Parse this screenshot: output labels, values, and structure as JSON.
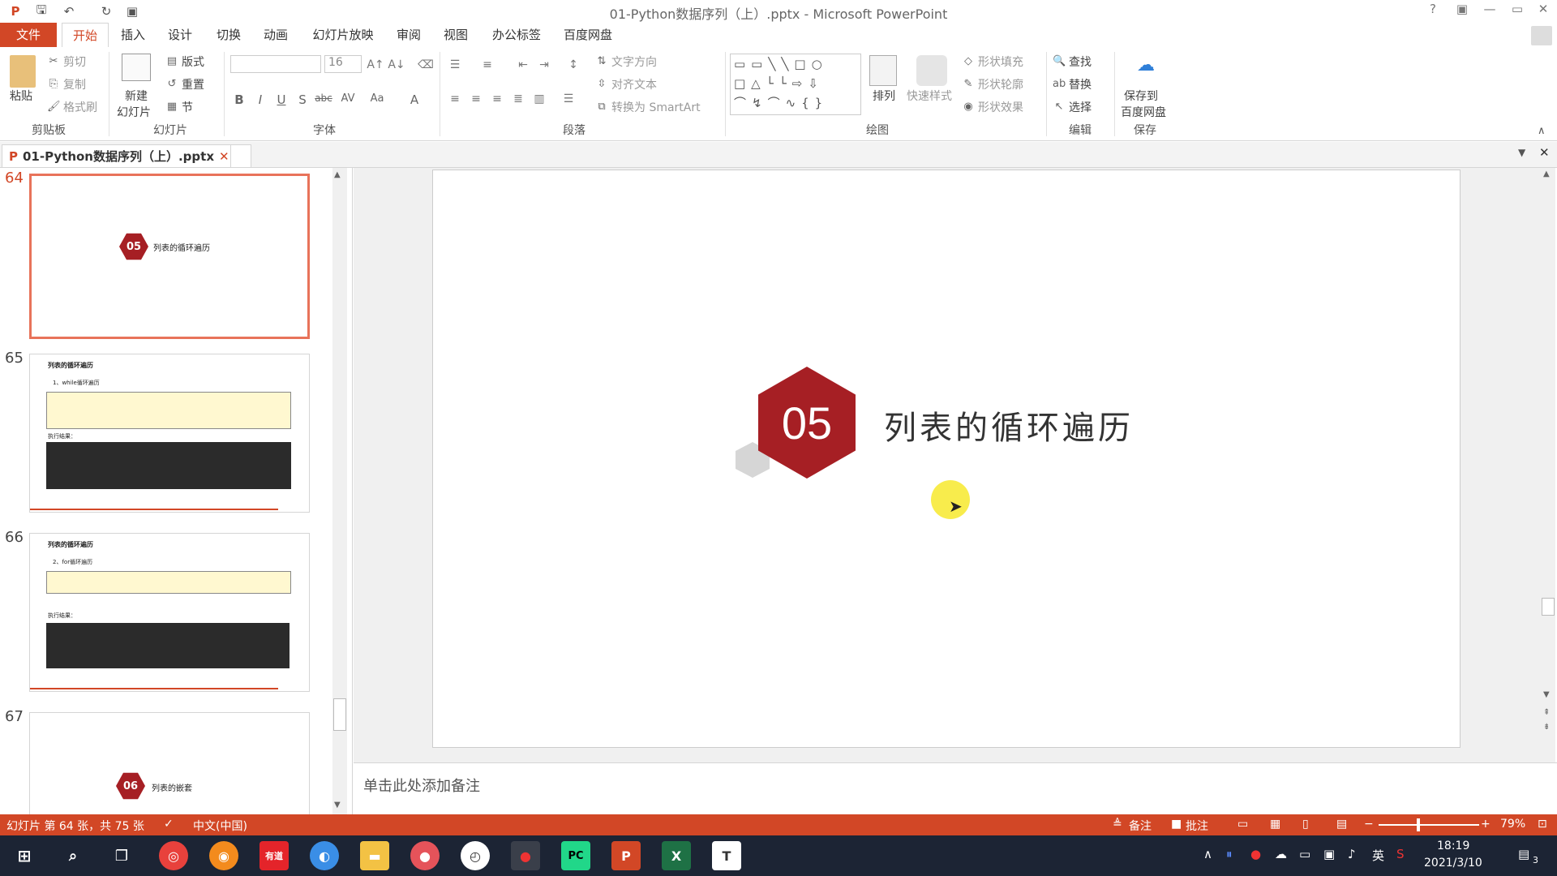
{
  "window": {
    "title": "01-Python数据序列（上）.pptx - Microsoft PowerPoint",
    "help": "?",
    "min": "—",
    "max": "▭",
    "close": "✕"
  },
  "tabs": [
    "文件",
    "开始",
    "插入",
    "设计",
    "切换",
    "动画",
    "幻灯片放映",
    "审阅",
    "视图",
    "办公标签",
    "百度网盘"
  ],
  "ribbon": {
    "clipboard": {
      "paste": "粘贴",
      "cut": "剪切",
      "copy": "复制",
      "format_painter": "格式刷",
      "label": "剪贴板"
    },
    "slides": {
      "new": "新建",
      "new2": "幻灯片",
      "layout": "版式",
      "reset": "重置",
      "section": "节",
      "label": "幻灯片"
    },
    "font": {
      "name": "",
      "size": "16",
      "label": "字体"
    },
    "paragraph": {
      "text_direction": "文字方向",
      "align_text": "对齐文本",
      "smartart": "转换为 SmartArt",
      "label": "段落"
    },
    "drawing": {
      "arrange": "排列",
      "quick_styles": "快速样式",
      "fill": "形状填充",
      "outline": "形状轮廓",
      "effects": "形状效果",
      "label": "绘图"
    },
    "editing": {
      "find": "查找",
      "replace": "替换",
      "select": "选择",
      "label": "编辑"
    },
    "save": {
      "save_to": "保存到",
      "baidu": "百度网盘",
      "label": "保存"
    }
  },
  "doc_tab": {
    "name": "01-Python数据序列（上）.pptx"
  },
  "thumbnails": [
    {
      "num": "64",
      "badge": "05",
      "title": "列表的循环遍历",
      "selected": true
    },
    {
      "num": "65",
      "title": "列表的循环遍历",
      "subtitle": "1、while循环遍历",
      "result": "执行结果："
    },
    {
      "num": "66",
      "title": "列表的循环遍历",
      "subtitle": "2、for循环遍历",
      "result": "执行结果："
    },
    {
      "num": "67",
      "badge": "06",
      "title": "列表的嵌套"
    }
  ],
  "slide": {
    "badge": "05",
    "title": "列表的循环遍历"
  },
  "notes": {
    "placeholder": "单击此处添加备注"
  },
  "status": {
    "slide_info": "幻灯片 第 64 张，共 75 张",
    "language": "中文(中国)",
    "notes": "备注",
    "comments": "批注",
    "zoom": "79%",
    "zoom_level": 0.79
  },
  "taskbar": {
    "time": "18:19",
    "date": "2021/3/10",
    "ime": "英",
    "notif": "3",
    "apps": [
      "chrome",
      "firefox",
      "youdao",
      "browser",
      "explorer",
      "recorder",
      "clock",
      "obs",
      "pycharm",
      "powerpoint",
      "excel",
      "typora"
    ]
  },
  "colors": {
    "accent": "#d24726",
    "badge": "#a61f24"
  }
}
